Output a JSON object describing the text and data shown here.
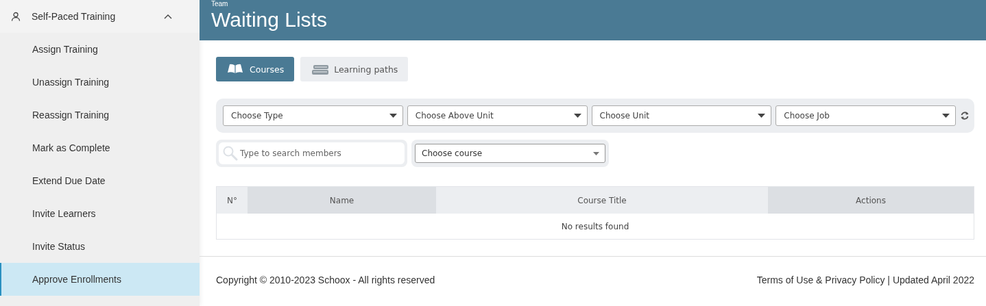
{
  "sidebar": {
    "group": {
      "label": "Self-Paced Training",
      "expanded": true
    },
    "items": [
      {
        "label": "Assign Training",
        "selected": false
      },
      {
        "label": "Unassign Training",
        "selected": false
      },
      {
        "label": "Reassign Training",
        "selected": false
      },
      {
        "label": "Mark as Complete",
        "selected": false
      },
      {
        "label": "Extend Due Date",
        "selected": false
      },
      {
        "label": "Invite Learners",
        "selected": false
      },
      {
        "label": "Invite Status",
        "selected": false
      },
      {
        "label": "Approve Enrollments",
        "selected": true
      }
    ]
  },
  "header": {
    "breadcrumb": "Team",
    "title": "Waiting Lists"
  },
  "tabs": [
    {
      "label": "Courses",
      "kind": "courses",
      "selected": true
    },
    {
      "label": "Learning paths",
      "kind": "paths",
      "selected": false
    }
  ],
  "filters": [
    "Choose Type",
    "Choose Above Unit",
    "Choose Unit",
    "Choose Job"
  ],
  "search": {
    "placeholder": "Type to search members"
  },
  "course_select": "Choose course",
  "table": {
    "columns": [
      "N°",
      "Name",
      "Course Title",
      "Actions"
    ],
    "empty": "No results found"
  },
  "footer": {
    "copyright": "Copyright © 2010-2023 Schoox - All rights reserved",
    "terms": "Terms of Use",
    "and": "&",
    "privacy": "Privacy Policy",
    "updated": "| Updated April 2022"
  }
}
